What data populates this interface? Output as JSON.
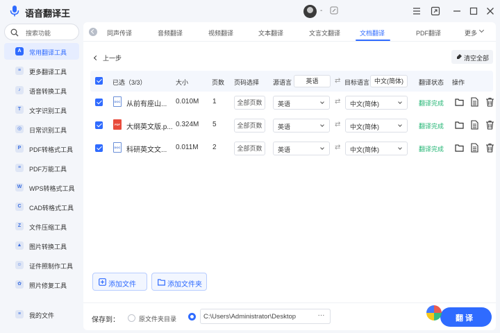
{
  "app": {
    "title": "语音翻译王",
    "username": "-"
  },
  "sidebar": {
    "search_label": "搜索功能",
    "items": [
      {
        "label": "常用翻译工具",
        "icon": "A"
      },
      {
        "label": "更多翻译工具",
        "icon": "≡"
      },
      {
        "label": "语音转换工具",
        "icon": "♪"
      },
      {
        "label": "文字识别工具",
        "icon": "T"
      },
      {
        "label": "日常识别工具",
        "icon": "◎"
      },
      {
        "label": "PDF转格式工具",
        "icon": "P"
      },
      {
        "label": "PDF万能工具",
        "icon": "≡"
      },
      {
        "label": "WPS转格式工具",
        "icon": "W"
      },
      {
        "label": "CAD转格式工具",
        "icon": "C"
      },
      {
        "label": "文件压缩工具",
        "icon": "Z"
      },
      {
        "label": "图片转换工具",
        "icon": "▲"
      },
      {
        "label": "证件照制作工具",
        "icon": "☺"
      },
      {
        "label": "照片修复工具",
        "icon": "✿"
      }
    ],
    "my_files": "我的文件"
  },
  "tabs": {
    "items": [
      "同声传译",
      "音频翻译",
      "视频翻译",
      "文本翻译",
      "文言文翻译",
      "文档翻译",
      "PDF翻译"
    ],
    "active": "文档翻译",
    "more": "更多"
  },
  "toolbar": {
    "back": "上一步",
    "clear_all": "清空全部"
  },
  "table": {
    "header": {
      "selected": "已选（3/3）",
      "size": "大小",
      "pages": "页数",
      "page_select": "页码选择",
      "source_lang": "源语言",
      "source_lang_value": "英语",
      "target_lang": "目标语言",
      "target_lang_value": "中文(简体)",
      "status": "翻译状态",
      "actions": "操作"
    },
    "rows": [
      {
        "name": "从前有座山...",
        "type": "doc",
        "size": "0.010M",
        "pages": "1",
        "page_select": "全部页数",
        "source": "英语",
        "target": "中文(简体)",
        "status": "翻译完成"
      },
      {
        "name": "大纲英文版.p...",
        "type": "pdf",
        "size": "0.324M",
        "pages": "5",
        "page_select": "全部页数",
        "source": "英语",
        "target": "中文(简体)",
        "status": "翻译完成"
      },
      {
        "name": "科研英文文...",
        "type": "doc",
        "size": "0.011M",
        "pages": "2",
        "page_select": "全部页数",
        "source": "英语",
        "target": "中文(简体)",
        "status": "翻译完成"
      }
    ]
  },
  "buttons": {
    "add_file": "添加文件",
    "add_folder": "添加文件夹"
  },
  "footer": {
    "save_to": "保存到：",
    "original_dir": "原文件夹目录",
    "path": "C:\\Users\\Administrator\\Desktop",
    "browse": "···",
    "translate": "翻 译"
  },
  "colors": {
    "accent": "#2f6bff",
    "success": "#22b573"
  }
}
